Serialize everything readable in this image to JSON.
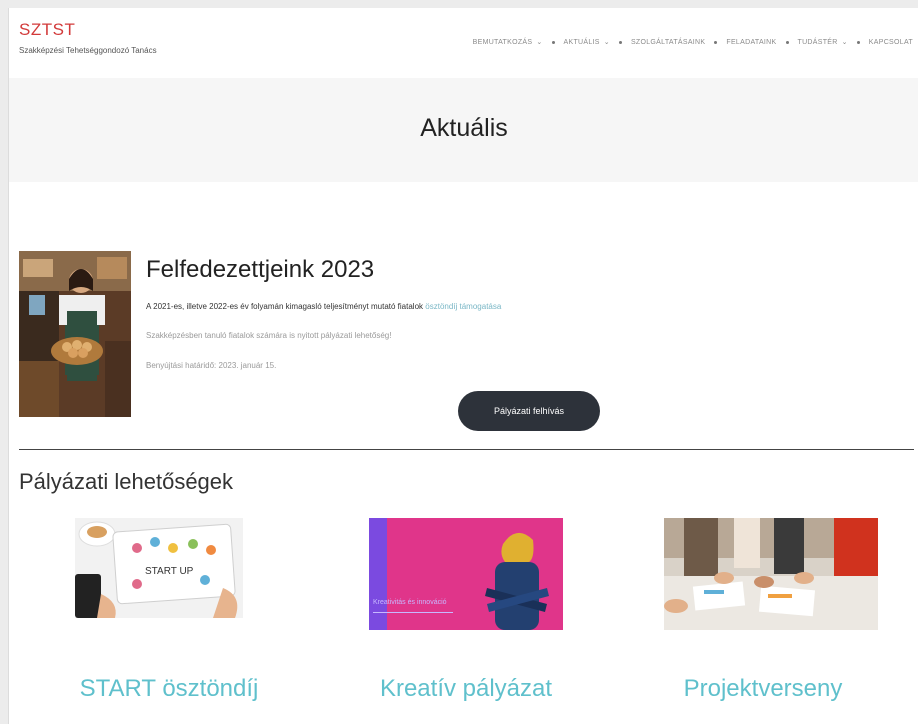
{
  "brand": {
    "title": "SZTST",
    "subtitle": "Szakképzési Tehetséggondozó Tanács"
  },
  "nav": {
    "items": [
      {
        "label": "BEMUTATKOZÁS",
        "has_dropdown": true
      },
      {
        "label": "AKTUÁLIS",
        "has_dropdown": true
      },
      {
        "label": "SZOLGÁLTATÁSAINK",
        "has_dropdown": false
      },
      {
        "label": "FELADATAINK",
        "has_dropdown": false
      },
      {
        "label": "TUDÁSTÉR",
        "has_dropdown": true
      },
      {
        "label": "KAPCSOLAT",
        "has_dropdown": false
      }
    ]
  },
  "page": {
    "title": "Aktuális"
  },
  "featured": {
    "title": "Felfedezettjeink 2023",
    "desc_main": "A 2021-es, illetve 2022-es év folyamán kimagasló teljesítményt mutató fiatalok",
    "desc_link": "ösztöndíj támogatása",
    "line2": "Szakképzésben tanuló fiatalok számára is nyitott pályázati lehetőség!",
    "line3": "Benyújtási határidő: 2023. január 15.",
    "cta_label": "Pályázati felhívás"
  },
  "section": {
    "title": "Pályázati lehetőségek"
  },
  "cards": [
    {
      "title": "START ösztöndíj",
      "image_text": "START UP"
    },
    {
      "title": "Kreatív pályázat",
      "image_text": "Kreativitás és innováció"
    },
    {
      "title": "Projektverseny"
    }
  ],
  "colors": {
    "brand_red": "#d23a3a",
    "accent_teal": "#5fc0cc",
    "button_dark": "#2d323a",
    "link": "#7ab7c6"
  }
}
